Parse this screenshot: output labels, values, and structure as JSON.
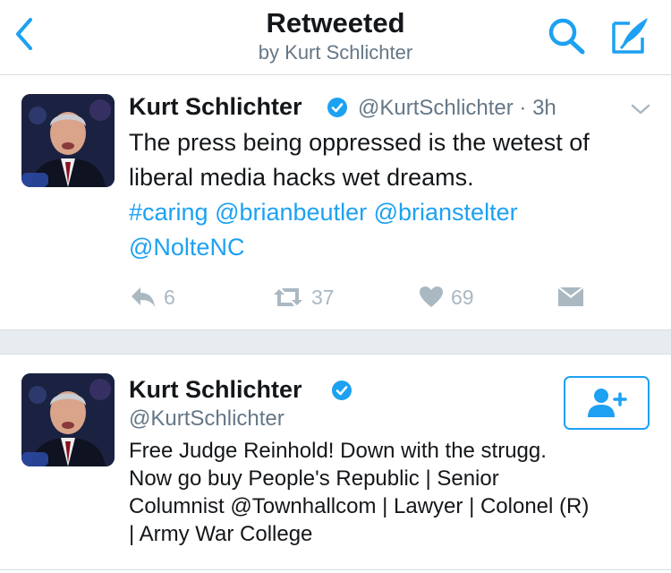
{
  "header": {
    "title": "Retweeted",
    "subtitle": "by Kurt Schlichter",
    "icons": [
      "back-chevron-icon",
      "search-icon",
      "compose-icon"
    ],
    "accent_color": "#1da1f2"
  },
  "tweet": {
    "author_name": "Kurt Schlichter",
    "handle_time": "@KurtSchlichter · 3h",
    "text": "The press being oppressed is the wetest of liberal media hacks wet dreams.",
    "hashtag": "#caring",
    "mentions": [
      "@brianbeutler",
      "@brianstelter",
      "@NolteNC"
    ],
    "actions": {
      "reply_count": "6",
      "retweet_count": "37",
      "like_count": "69"
    }
  },
  "profile_card": {
    "name": "Kurt Schlichter",
    "handle": "@KurtSchlichter",
    "bio_lines": [
      "Free Judge Reinhold! Down with the strugg.",
      "Now go buy People's Republic | Senior",
      "Columnist @Townhallcom | Lawyer | Colonel (R)",
      "| Army War College"
    ]
  },
  "colors": {
    "text": "#14171a",
    "muted": "#657786",
    "action_gray": "#aab8c2",
    "verified_blue": "#1da1f2",
    "separator": "#e6ecf0"
  }
}
